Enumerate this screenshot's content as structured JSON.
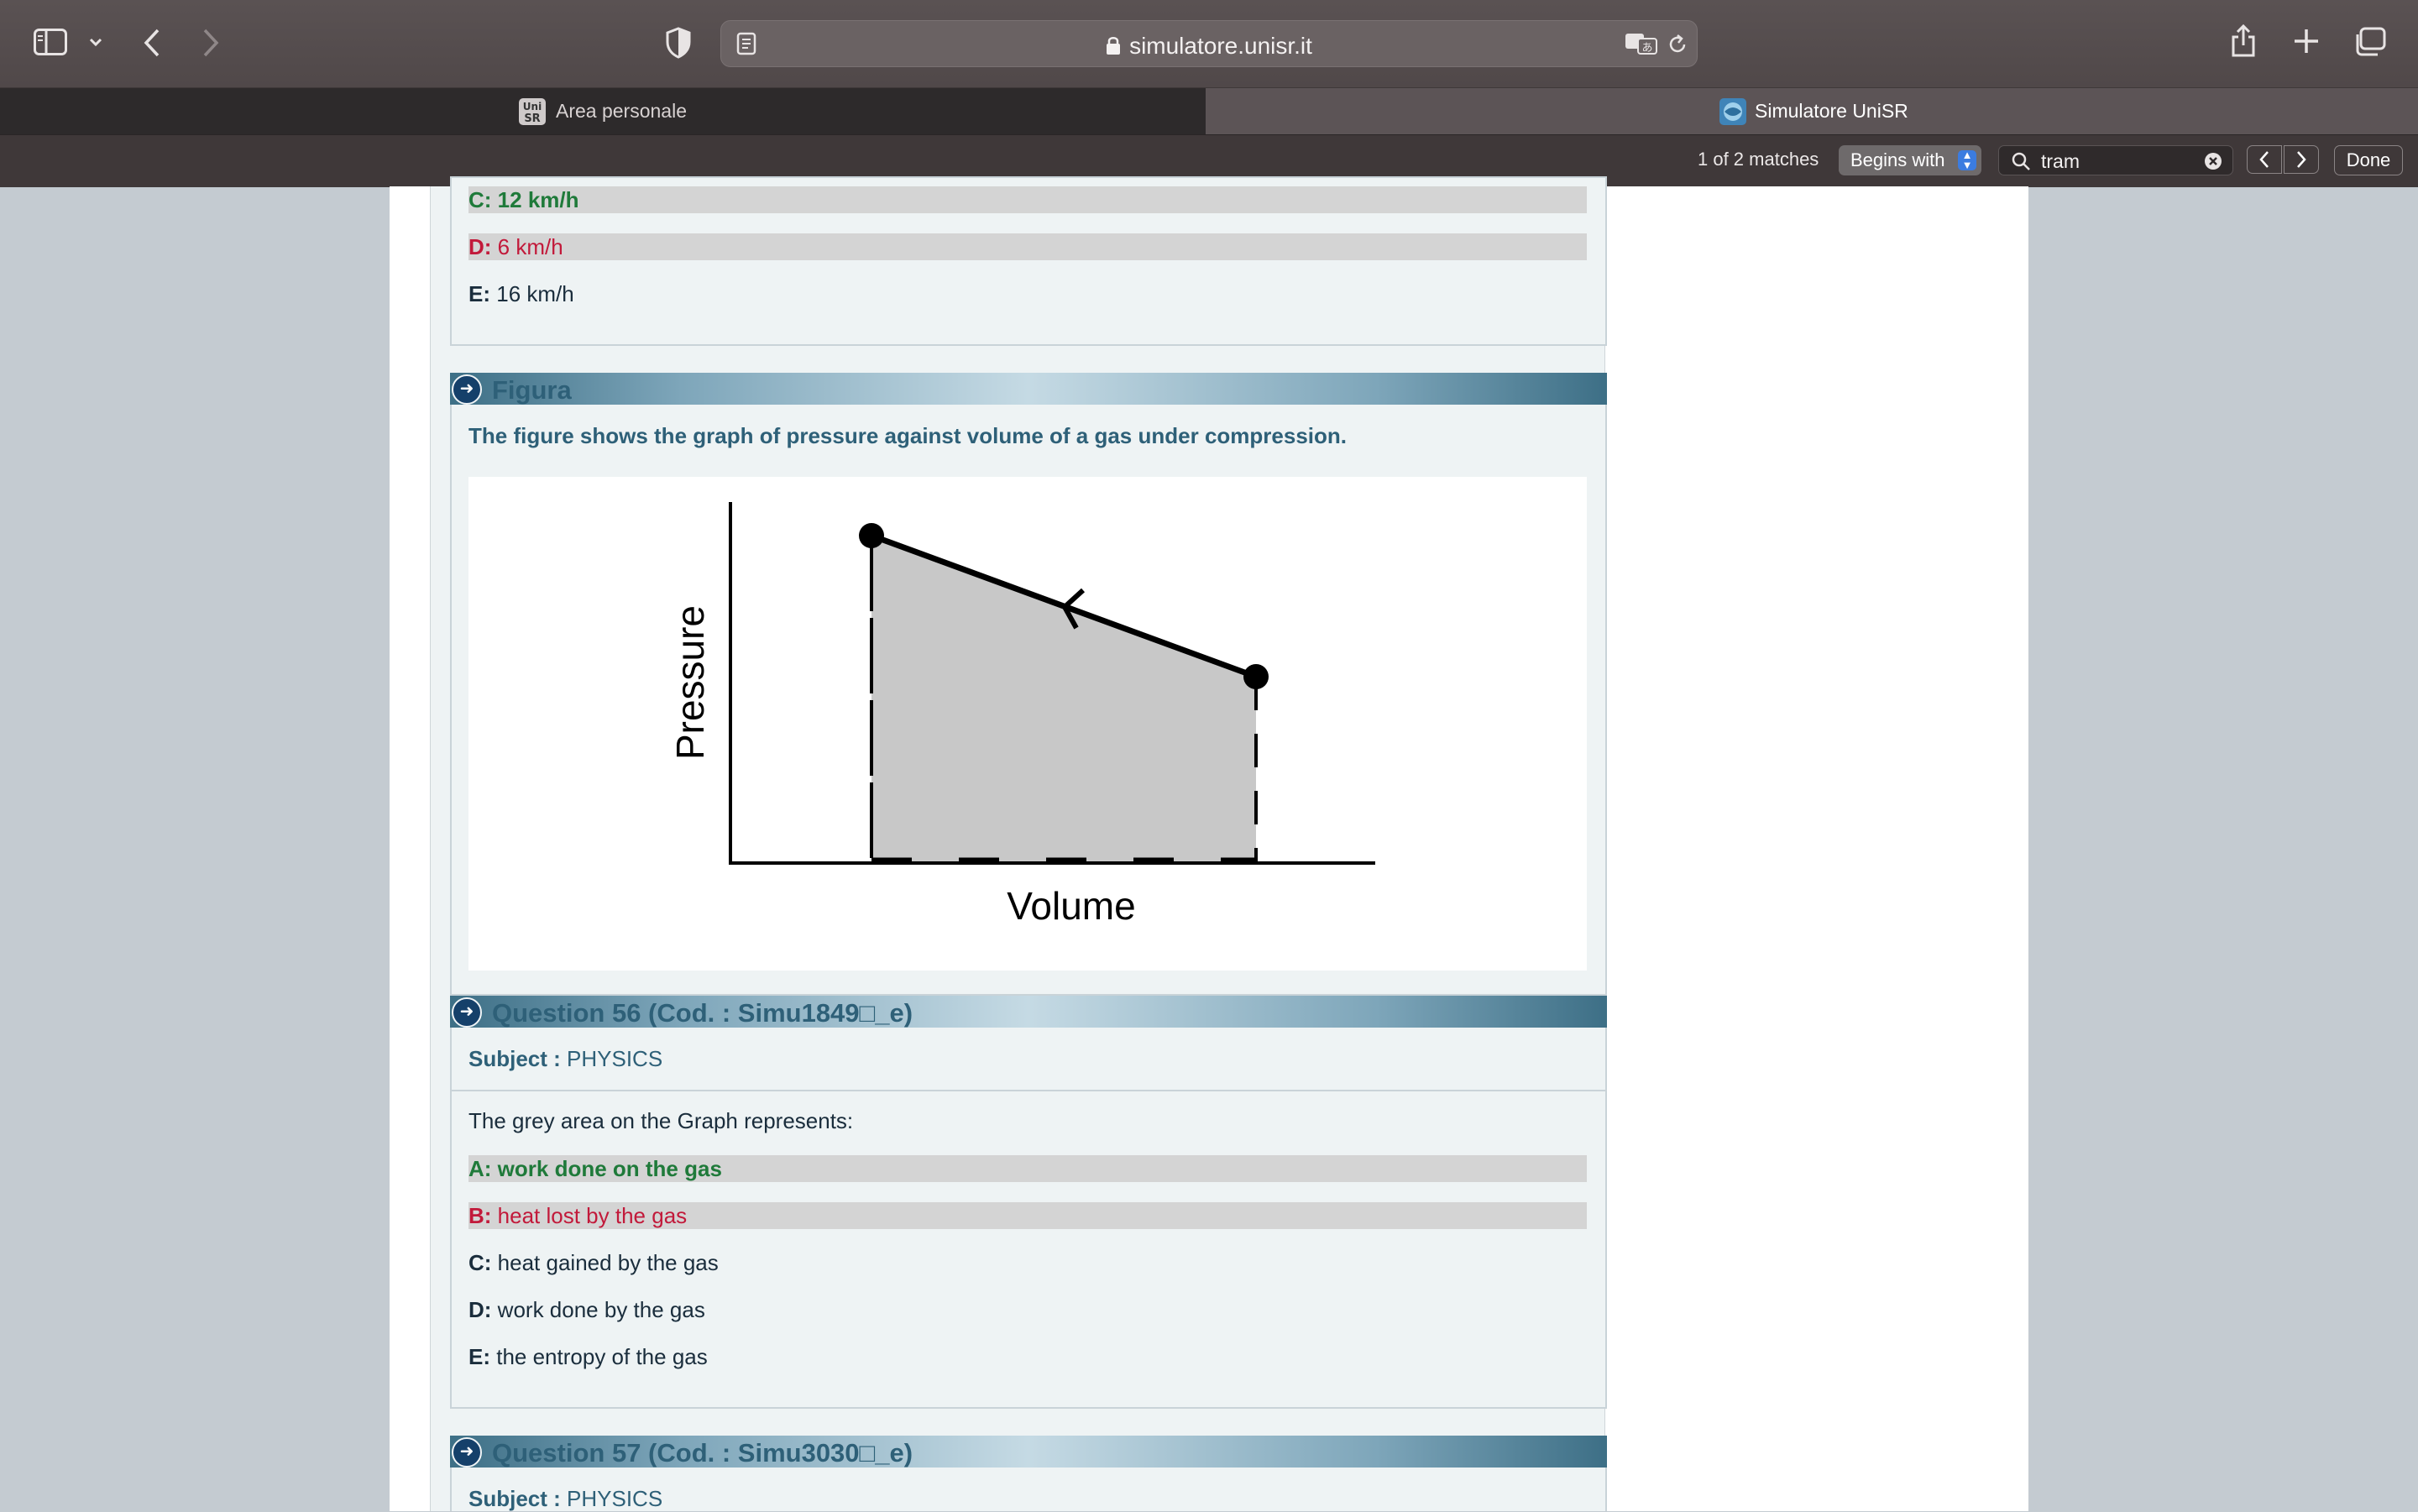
{
  "browser": {
    "url": "simulatore.unisr.it",
    "tabs": [
      {
        "label": "Area personale",
        "favicon_text": "Uni SR",
        "active": false
      },
      {
        "label": "Simulatore UniSR",
        "active": true
      }
    ],
    "find": {
      "matches": "1 of 2 matches",
      "mode": "Begins with",
      "query": "tram",
      "done_label": "Done"
    }
  },
  "prev_question_options": [
    {
      "letter": "C:",
      "text": "12 km/h",
      "state": "correct"
    },
    {
      "letter": "D:",
      "text": "6 km/h",
      "state": "wrong"
    },
    {
      "letter": "E:",
      "text": "16 km/h",
      "state": "normal"
    }
  ],
  "figure": {
    "title": "Figura",
    "caption": "The figure shows the graph of pressure against volume of a gas under compression.",
    "ylabel": "Pressure",
    "xlabel": "Volume"
  },
  "question56": {
    "title": "Question 56 (Cod. : Simu1849□_e)",
    "subject_label": "Subject :",
    "subject": "PHYSICS",
    "text": "The grey area on the Graph represents:",
    "options": [
      {
        "letter": "A:",
        "text": "work done on the gas",
        "state": "correct"
      },
      {
        "letter": "B:",
        "text": "heat lost by the gas",
        "state": "wrong"
      },
      {
        "letter": "C:",
        "text": "heat gained by the gas",
        "state": "normal"
      },
      {
        "letter": "D:",
        "text": "work done by the gas",
        "state": "normal"
      },
      {
        "letter": "E:",
        "text": "the entropy of the gas",
        "state": "normal"
      }
    ]
  },
  "question57": {
    "title": "Question 57 (Cod. : Simu3030□_e)",
    "subject_label": "Subject :",
    "subject": "PHYSICS"
  },
  "colors": {
    "correct": "#1f7a3a",
    "wrong": "#c2193a",
    "heading": "#2e6078",
    "highlight": "#d4d4d4"
  }
}
